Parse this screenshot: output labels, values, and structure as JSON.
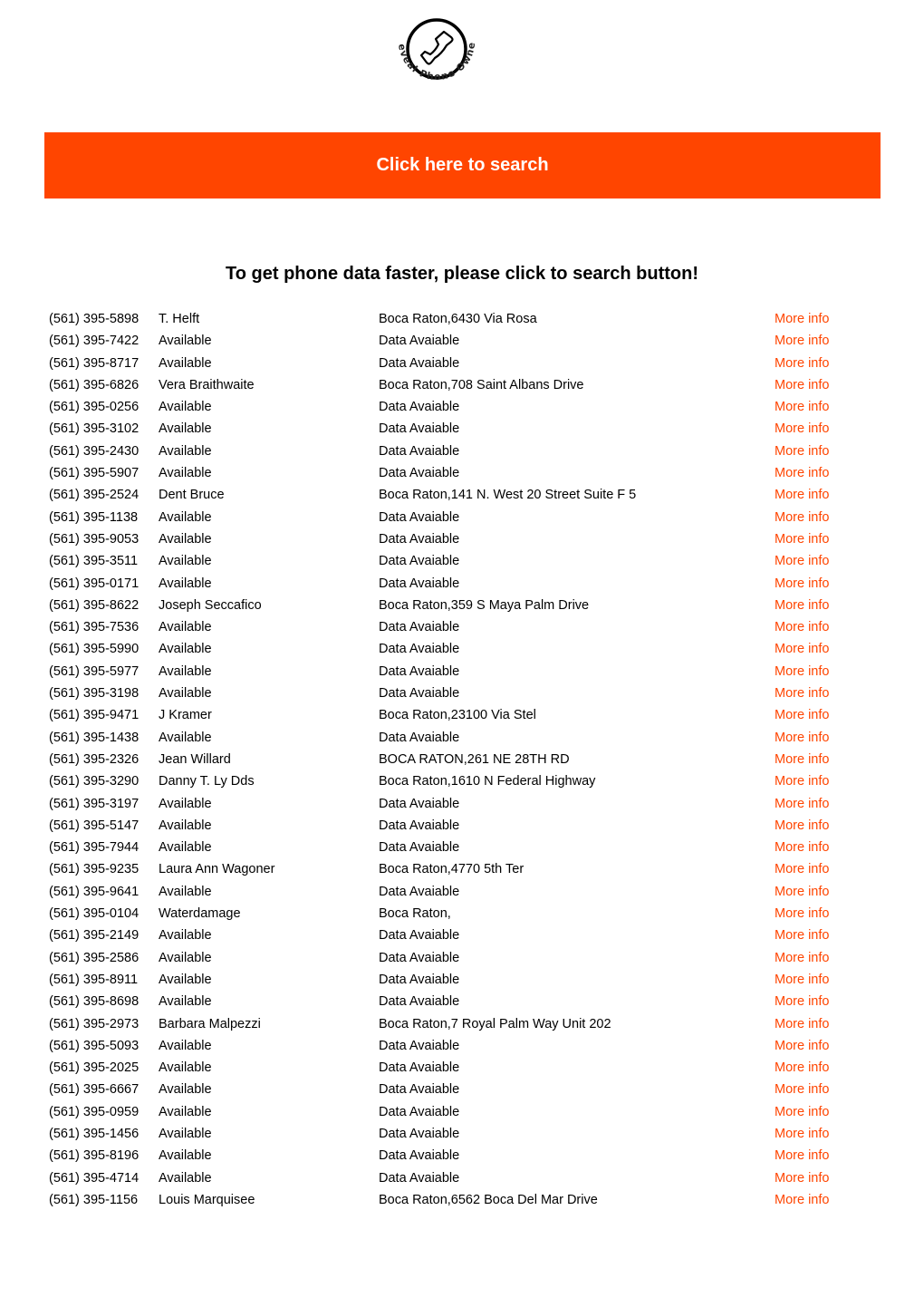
{
  "logo": {
    "icon": "phone-handset-icon",
    "arc_text": "Reveal Phone Owner"
  },
  "search_button": {
    "label": "Click here to search",
    "color": "#ff4500"
  },
  "headline": "To get phone data faster, please click to search button!",
  "link_color": "#ff4500",
  "rows": [
    {
      "phone": "(561) 395-5898",
      "name": "T. Helft",
      "address": "Boca Raton,6430 Via Rosa",
      "link": "More info"
    },
    {
      "phone": "(561) 395-7422",
      "name": "Available",
      "address": "Data Avaiable",
      "link": "More info"
    },
    {
      "phone": "(561) 395-8717",
      "name": "Available",
      "address": "Data Avaiable",
      "link": "More info"
    },
    {
      "phone": "(561) 395-6826",
      "name": "Vera Braithwaite",
      "address": "Boca Raton,708 Saint Albans Drive",
      "link": "More info"
    },
    {
      "phone": "(561) 395-0256",
      "name": "Available",
      "address": "Data Avaiable",
      "link": "More info"
    },
    {
      "phone": "(561) 395-3102",
      "name": "Available",
      "address": "Data Avaiable",
      "link": "More info"
    },
    {
      "phone": "(561) 395-2430",
      "name": "Available",
      "address": "Data Avaiable",
      "link": "More info"
    },
    {
      "phone": "(561) 395-5907",
      "name": "Available",
      "address": "Data Avaiable",
      "link": "More info"
    },
    {
      "phone": "(561) 395-2524",
      "name": "Dent Bruce",
      "address": "Boca Raton,141 N. West 20 Street Suite F 5",
      "link": "More info"
    },
    {
      "phone": "(561) 395-1138",
      "name": "Available",
      "address": "Data Avaiable",
      "link": "More info"
    },
    {
      "phone": "(561) 395-9053",
      "name": "Available",
      "address": "Data Avaiable",
      "link": "More info"
    },
    {
      "phone": "(561) 395-3511",
      "name": "Available",
      "address": "Data Avaiable",
      "link": "More info"
    },
    {
      "phone": "(561) 395-0171",
      "name": "Available",
      "address": "Data Avaiable",
      "link": "More info"
    },
    {
      "phone": "(561) 395-8622",
      "name": "Joseph Seccafico",
      "address": "Boca Raton,359 S Maya Palm Drive",
      "link": "More info"
    },
    {
      "phone": "(561) 395-7536",
      "name": "Available",
      "address": "Data Avaiable",
      "link": "More info"
    },
    {
      "phone": "(561) 395-5990",
      "name": "Available",
      "address": "Data Avaiable",
      "link": "More info"
    },
    {
      "phone": "(561) 395-5977",
      "name": "Available",
      "address": "Data Avaiable",
      "link": "More info"
    },
    {
      "phone": "(561) 395-3198",
      "name": "Available",
      "address": "Data Avaiable",
      "link": "More info"
    },
    {
      "phone": "(561) 395-9471",
      "name": "J Kramer",
      "address": "Boca Raton,23100 Via Stel",
      "link": "More info"
    },
    {
      "phone": "(561) 395-1438",
      "name": "Available",
      "address": "Data Avaiable",
      "link": "More info"
    },
    {
      "phone": "(561) 395-2326",
      "name": "Jean Willard",
      "address": "BOCA RATON,261 NE 28TH RD",
      "link": "More info"
    },
    {
      "phone": "(561) 395-3290",
      "name": "Danny T. Ly Dds",
      "address": "Boca Raton,1610 N Federal Highway",
      "link": "More info"
    },
    {
      "phone": "(561) 395-3197",
      "name": "Available",
      "address": "Data Avaiable",
      "link": "More info"
    },
    {
      "phone": "(561) 395-5147",
      "name": "Available",
      "address": "Data Avaiable",
      "link": "More info"
    },
    {
      "phone": "(561) 395-7944",
      "name": "Available",
      "address": "Data Avaiable",
      "link": "More info"
    },
    {
      "phone": "(561) 395-9235",
      "name": "Laura Ann Wagoner",
      "address": "Boca Raton,4770 5th Ter",
      "link": "More info"
    },
    {
      "phone": "(561) 395-9641",
      "name": "Available",
      "address": "Data Avaiable",
      "link": "More info"
    },
    {
      "phone": "(561) 395-0104",
      "name": "Waterdamage",
      "address": "Boca Raton,",
      "link": "More info"
    },
    {
      "phone": "(561) 395-2149",
      "name": "Available",
      "address": "Data Avaiable",
      "link": "More info"
    },
    {
      "phone": "(561) 395-2586",
      "name": "Available",
      "address": "Data Avaiable",
      "link": "More info"
    },
    {
      "phone": "(561) 395-8911",
      "name": "Available",
      "address": "Data Avaiable",
      "link": "More info"
    },
    {
      "phone": "(561) 395-8698",
      "name": "Available",
      "address": "Data Avaiable",
      "link": "More info"
    },
    {
      "phone": "(561) 395-2973",
      "name": "Barbara Malpezzi",
      "address": "Boca Raton,7 Royal Palm Way Unit 202",
      "link": "More info"
    },
    {
      "phone": "(561) 395-5093",
      "name": "Available",
      "address": "Data Avaiable",
      "link": "More info"
    },
    {
      "phone": "(561) 395-2025",
      "name": "Available",
      "address": "Data Avaiable",
      "link": "More info"
    },
    {
      "phone": "(561) 395-6667",
      "name": "Available",
      "address": "Data Avaiable",
      "link": "More info"
    },
    {
      "phone": "(561) 395-0959",
      "name": "Available",
      "address": "Data Avaiable",
      "link": "More info"
    },
    {
      "phone": "(561) 395-1456",
      "name": "Available",
      "address": "Data Avaiable",
      "link": "More info"
    },
    {
      "phone": "(561) 395-8196",
      "name": "Available",
      "address": "Data Avaiable",
      "link": "More info"
    },
    {
      "phone": "(561) 395-4714",
      "name": "Available",
      "address": "Data Avaiable",
      "link": "More info"
    },
    {
      "phone": "(561) 395-1156",
      "name": "Louis Marquisee",
      "address": "Boca Raton,6562 Boca Del Mar Drive",
      "link": "More info"
    }
  ]
}
